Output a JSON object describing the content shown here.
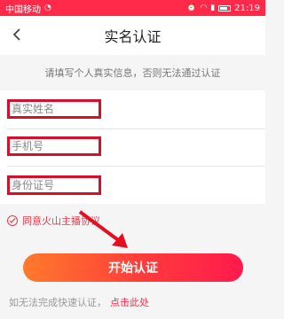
{
  "status_bar": {
    "carrier": "中国移动",
    "time": "21:19",
    "icons": [
      "signal-icon",
      "wifi-icon",
      "alarm-icon",
      "battery-icon"
    ],
    "bg_color": "#ff2a4a"
  },
  "header": {
    "title": "实名认证",
    "back_icon": "chevron-left-icon"
  },
  "notice": {
    "text": "请填写个人真实信息，否则无法通过认证"
  },
  "form": {
    "name_placeholder": "真实姓名",
    "phone_placeholder": "手机号",
    "id_placeholder": "身份证号",
    "highlight_color": "#d3112b"
  },
  "agreement": {
    "checked": true,
    "label": "同意火山主播协议",
    "color": "#e83b4a"
  },
  "actions": {
    "start_label": "开始认证"
  },
  "fallback": {
    "text": "如无法完成快速认证，",
    "link": "点击此处"
  },
  "colors": {
    "accent": "#ff2a4a",
    "button_gradient_start": "#ff7a2c",
    "button_gradient_end": "#ff1a4d"
  }
}
